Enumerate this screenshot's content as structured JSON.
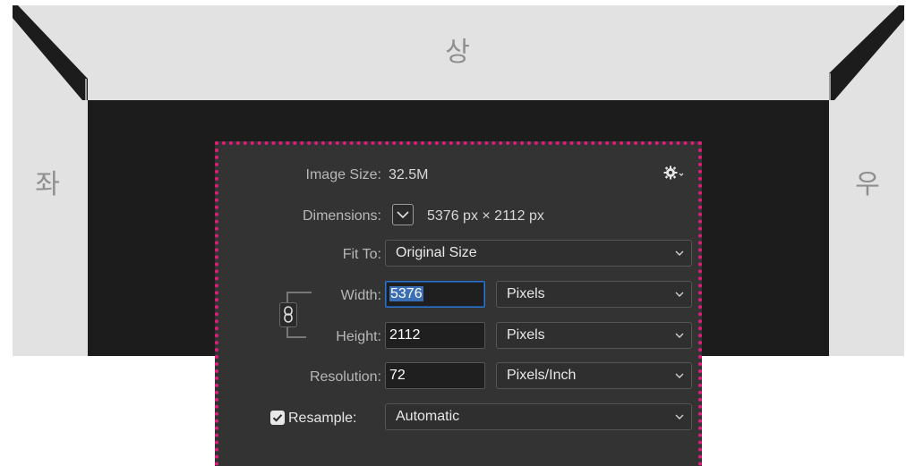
{
  "scene": {
    "top_label": "상",
    "left_label": "좌",
    "right_label": "우"
  },
  "dialog": {
    "image_size_label": "Image Size:",
    "image_size_value": "32.5M",
    "settings_icon": "gear-icon",
    "dimensions_label": "Dimensions:",
    "dimensions_value": "5376 px × 2112 px",
    "fit_to_label": "Fit To:",
    "fit_to_value": "Original Size",
    "width_label": "Width:",
    "width_value": "5376",
    "width_unit": "Pixels",
    "height_label": "Height:",
    "height_value": "2112",
    "height_unit": "Pixels",
    "resolution_label": "Resolution:",
    "resolution_value": "72",
    "resolution_unit": "Pixels/Inch",
    "resample_label": "Resample:",
    "resample_checked": true,
    "resample_value": "Automatic"
  },
  "colors": {
    "dialog_bg": "#333333",
    "highlight_border": "#e01c78",
    "focus_blue": "#2f74c9"
  }
}
